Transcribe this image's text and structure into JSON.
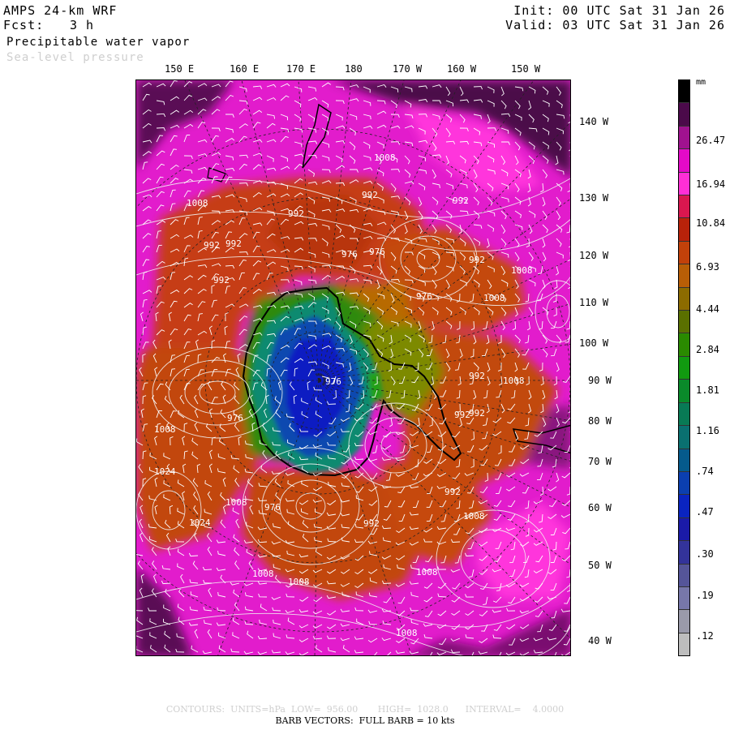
{
  "header": {
    "model": "AMPS 24-km WRF",
    "forecast_label": "Fcst:",
    "forecast_value": "3 h",
    "field_primary": "Precipitable water vapor",
    "field_secondary": "Sea-level pressure",
    "init": "Init: 00 UTC Sat 31 Jan 26",
    "valid": "Valid: 03 UTC Sat 31 Jan 26"
  },
  "longitude_labels": [
    "150 E",
    "160 E",
    "170 E",
    "180",
    "170 W",
    "160 W",
    "150 W"
  ],
  "right_labels": [
    "140 W",
    "130 W",
    "120 W",
    "110 W",
    "100 W",
    "90 W",
    "80 W",
    "70 W",
    "60 W",
    "50 W",
    "40 W"
  ],
  "colorbar": {
    "unit": "mm",
    "labels": [
      "26.47",
      "16.94",
      "10.84",
      "6.93",
      "4.44",
      "2.84",
      "1.81",
      "1.16",
      ".74",
      ".47",
      ".30",
      ".19",
      ".12"
    ],
    "colors": [
      "#000000",
      "#4b0a4a",
      "#a0128f",
      "#e40ac8",
      "#ff2fd6",
      "#d9174f",
      "#b8220a",
      "#c2410a",
      "#b85e06",
      "#8c6b00",
      "#5a7000",
      "#2a8a00",
      "#119a10",
      "#0a8a2a",
      "#087a55",
      "#0a7070",
      "#055a8c",
      "#0b3fb0",
      "#0a24c0",
      "#1a1aa8",
      "#33339a",
      "#555599",
      "#7777aa",
      "#9a9aaa",
      "#bdbdbd"
    ]
  },
  "pressure_labels": [
    "1008",
    "992",
    "992",
    "976",
    "976",
    "992",
    "1008",
    "992",
    "976",
    "976",
    "992",
    "992",
    "1008",
    "1008",
    "992",
    "976",
    "992",
    "1024",
    "1008",
    "976",
    "992",
    "1008",
    "1024",
    "1008",
    "1008",
    "1008",
    "992",
    "1008",
    "992",
    "992",
    "1008",
    "1008"
  ],
  "footer": {
    "contours": "CONTOURS:  UNITS=hPa  LOW=  956.00       HIGH=  1028.0      INTERVAL=    4.0000",
    "barbs": "BARB VECTORS:  FULL BARB = 10 kts"
  }
}
